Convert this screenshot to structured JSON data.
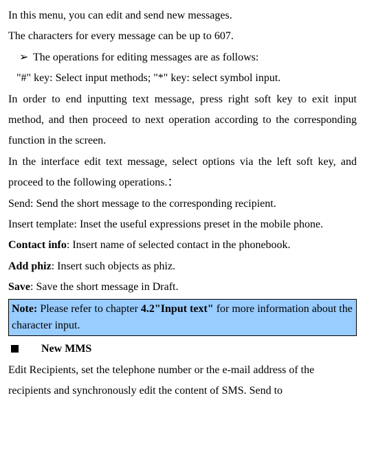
{
  "p1": "In this menu, you can edit and send new messages.",
  "p2": "The characters for every message can be up to 607.",
  "bullet1": "The operations for editing messages are as follows:",
  "p3": "\"#\" key: Select input methods; \"*\" key: select symbol input.",
  "p4": "In order to end inputting text message, press right soft key to exit input method, and then proceed to next operation according to the corresponding function in the screen.",
  "p5": "In the interface edit text message, select options via the left soft key, and proceed to the following operations.：",
  "p6": "Send: Send the short message to the corresponding recipient.",
  "p7": "Insert template: Inset the useful expressions preset in the mobile phone.",
  "p8a": "Contact info",
  "p8b": ": Insert name of selected contact in the phonebook.",
  "p9a": "Add phiz",
  "p9b": ": Insert such objects as phiz.",
  "p10a": "Save",
  "p10b": ": Save the short message in Draft.",
  "note_a": "Note:",
  "note_b": " Please refer to chapter ",
  "note_c": "4.2\"Input text\"",
  "note_d": " for more information about the character input.",
  "sec1": "New MMS",
  "p11": "Edit Recipients, set the telephone number or the e-mail address of the recipients and synchronously edit the content of SMS. Send to"
}
